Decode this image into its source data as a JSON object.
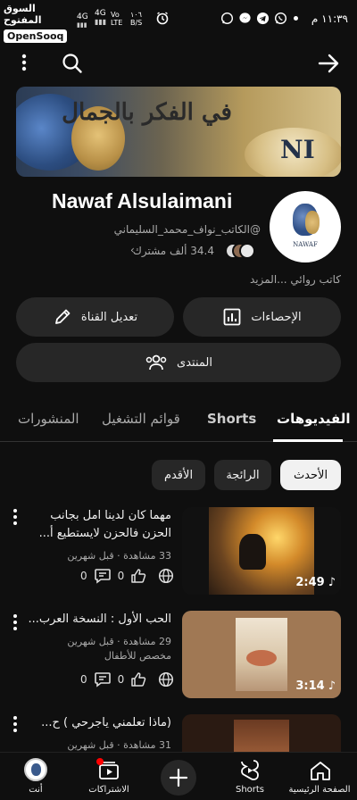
{
  "status_bar": {
    "time": "١١:٣٩ م",
    "net1": "4G",
    "net2": "4G",
    "volte": "Vo LTE",
    "speed": "١٠٦ B/S"
  },
  "watermark": {
    "arabic": "السوق المفتوح",
    "english": "OpenSooq"
  },
  "channel": {
    "banner_text": "في الفكر بالجمال",
    "name": "Nawaf Alsulaimani",
    "handle": "@الكاتب_نواف_محمد_السليماني",
    "subscribers": "34.4 ألف مشترك",
    "description": "كاتب روائي ...المزيد"
  },
  "buttons": {
    "stats": "الإحصاءات",
    "edit": "تعديل القناة",
    "forum": "المنتدى"
  },
  "tabs": [
    "الفيديوهات",
    "Shorts",
    "قوائم التشغيل",
    "المنشورات"
  ],
  "chips": [
    "الأحدث",
    "الرائجة",
    "الأقدم"
  ],
  "videos": [
    {
      "title_line1": "مهما كان لدينا امل بجانب",
      "title_line2": "الحزن فالحزن لايستطيع أ...",
      "meta": "33 مشاهدة · قبل شهرين",
      "meta2": "",
      "duration": "2:49",
      "likes": "0",
      "comments": "0"
    },
    {
      "title_line1": "الحب الأول : النسخة العرب...",
      "title_line2": "",
      "meta": "29 مشاهدة · قبل شهرين",
      "meta2": "مخصص للأطفال",
      "duration": "3:14",
      "likes": "0",
      "comments": "0"
    },
    {
      "title_line1": "(ماذا تعلمني ياجرحي ) ح...",
      "title_line2": "",
      "meta": "31 مشاهدة · قبل شهرين",
      "meta2": "",
      "duration": "",
      "likes": "",
      "comments": ""
    }
  ],
  "bottom_nav": {
    "home": "الصفحة الرئيسية",
    "shorts": "Shorts",
    "subscriptions": "الاشتراكات",
    "you": "أنت"
  },
  "colors": {
    "background": "#0f0f0f",
    "pill": "#272727",
    "accent": "#ff0000"
  }
}
